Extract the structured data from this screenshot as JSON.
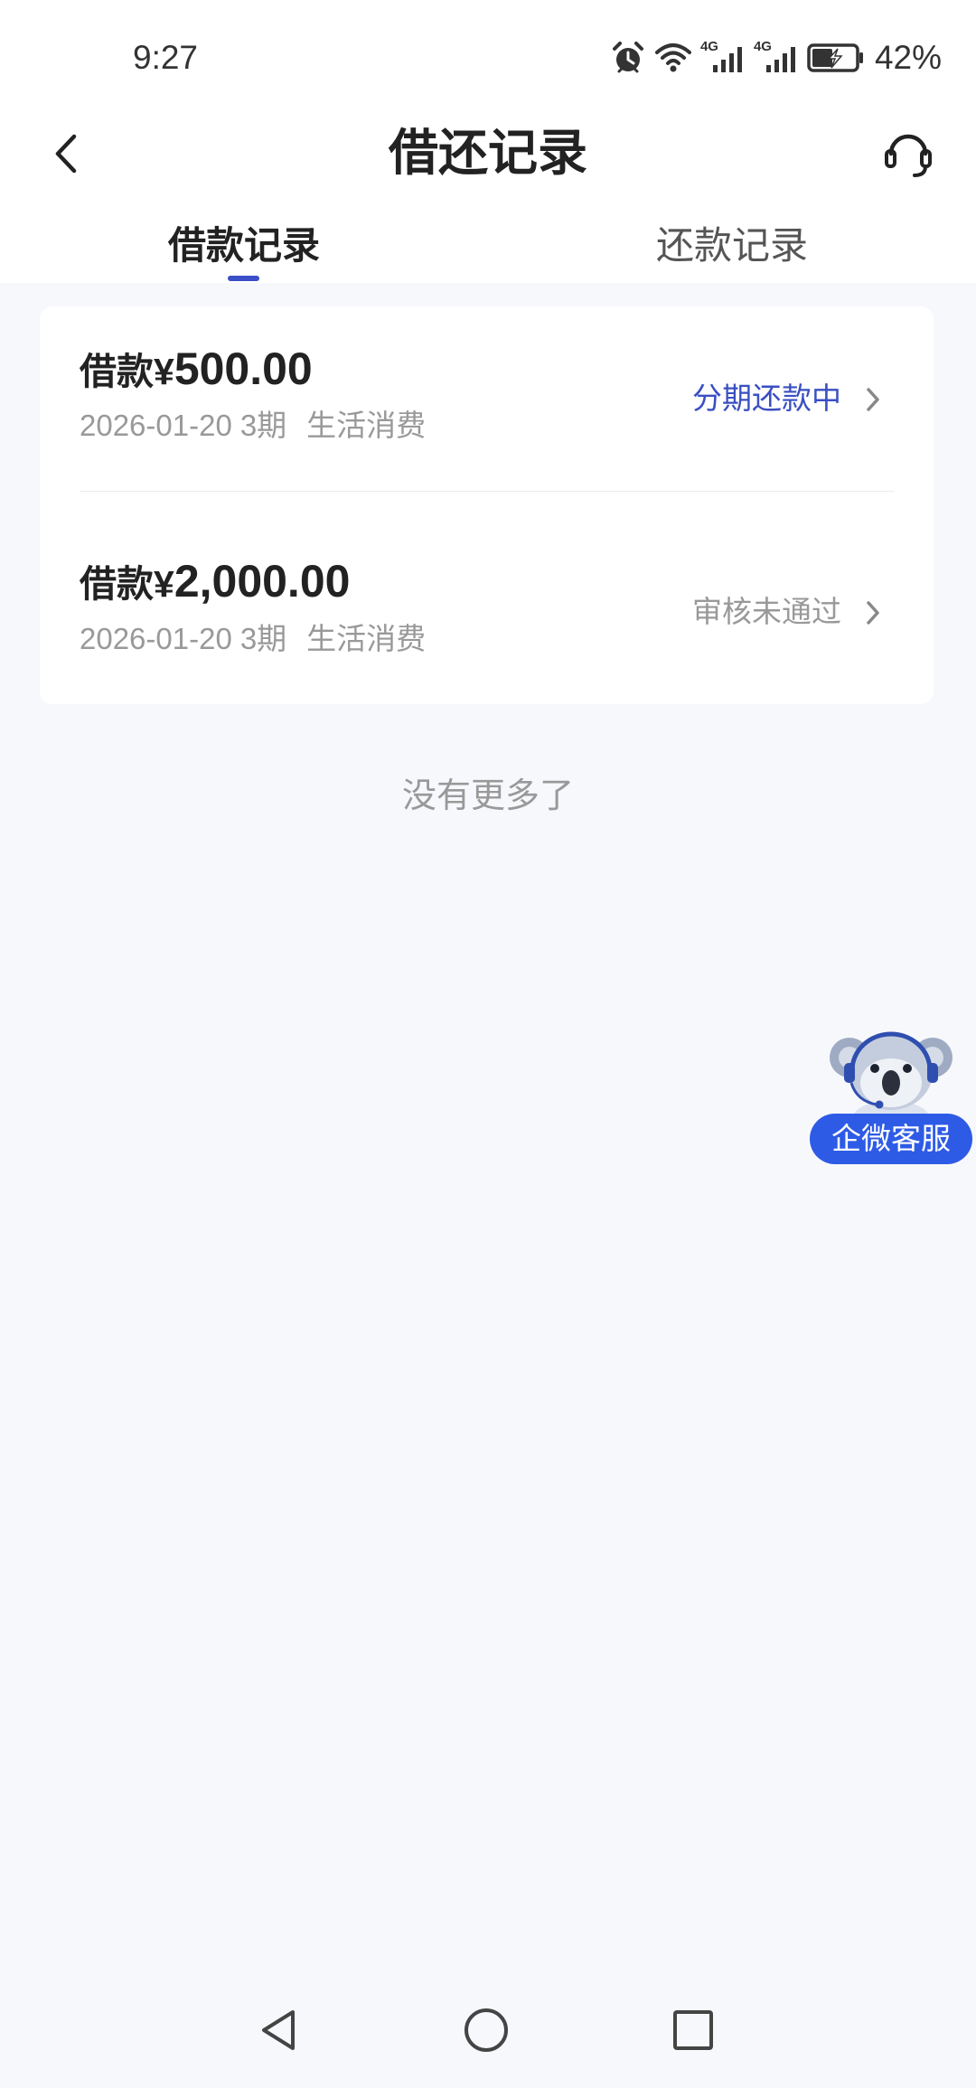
{
  "theme": {
    "accent": "#3b4fc8",
    "page_background": "#f7f8fc",
    "service_badge_color": "#2e5be6"
  },
  "status_bar": {
    "time": "9:27",
    "sim1_network": "4G",
    "sim2_network": "4G",
    "battery_percent": "42%",
    "icons": [
      "alarm-icon",
      "wifi-icon",
      "signal-icon",
      "signal-icon",
      "battery-charging-icon"
    ]
  },
  "header": {
    "title": "借还记录",
    "back_icon": "chevron-left-icon",
    "service_icon": "headset-icon"
  },
  "tabs": [
    {
      "label": "借款记录",
      "active": true
    },
    {
      "label": "还款记录",
      "active": false
    }
  ],
  "records": [
    {
      "label": "借款¥",
      "amount": "500.00",
      "date": "2026-01-20",
      "term": "3期",
      "purpose": "生活消费",
      "status": "分期还款中",
      "status_color": "#3a4fc2"
    },
    {
      "label": "借款¥",
      "amount": "2,000.00",
      "date": "2026-01-20",
      "term": "3期",
      "purpose": "生活消费",
      "status": "审核未通过",
      "status_color": "#999999"
    }
  ],
  "list_end_text": "没有更多了",
  "floating_service": {
    "label": "企微客服",
    "icon": "koala-mascot-icon"
  },
  "nav_bar": {
    "icons": [
      "back-triangle-icon",
      "home-circle-icon",
      "recents-square-icon"
    ]
  }
}
